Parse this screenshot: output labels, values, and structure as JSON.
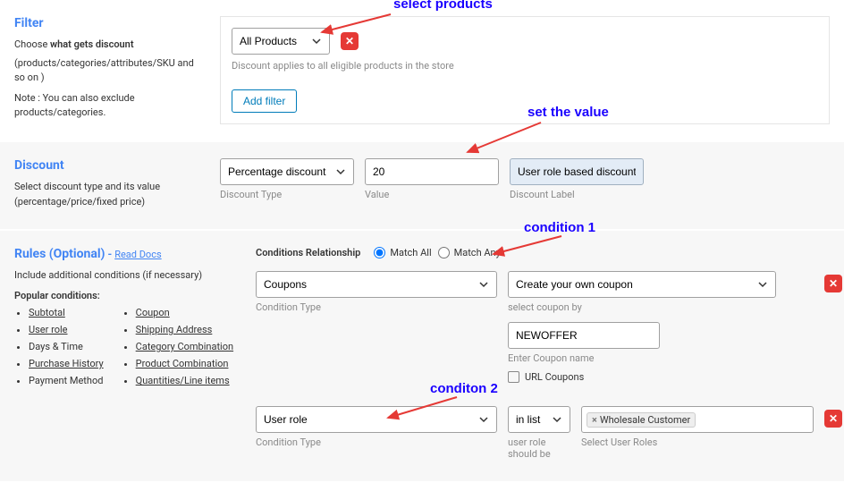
{
  "filter": {
    "title": "Filter",
    "choose_text": "Choose",
    "choose_bold": "what gets discount",
    "choose_rest": "(products/categories/attributes/SKU and so on )",
    "note": "Note : You can also exclude products/categories.",
    "select_value": "All Products",
    "applies_text": "Discount applies to all eligible products in the store",
    "add_filter": "Add filter"
  },
  "discount": {
    "title": "Discount",
    "side_text": "Select discount type and its value (percentage/price/fixed price)",
    "type_value": "Percentage discount",
    "type_label": "Discount Type",
    "value_value": "20",
    "value_label": "Value",
    "discount_label_value": "User role based discount",
    "discount_label_label": "Discount Label"
  },
  "rules": {
    "title": "Rules (Optional)",
    "read_docs": "Read Docs",
    "include_text": "Include additional conditions (if necessary)",
    "popular_label": "Popular conditions:",
    "col1": [
      "Subtotal",
      "User role",
      "Days & Time",
      "Purchase History",
      "Payment Method"
    ],
    "col2": [
      "Coupon",
      "Shipping Address",
      "Category Combination",
      "Product Combination",
      "Quantities/Line items"
    ],
    "relationship_label": "Conditions Relationship",
    "match_all": "Match All",
    "match_any": "Match Any",
    "cond1": {
      "type_value": "Coupons",
      "type_label": "Condition Type",
      "method_value": "Create your own coupon",
      "method_label": "select coupon by",
      "coupon_value": "NEWOFFER",
      "coupon_label": "Enter Coupon name",
      "url_coupons": "URL Coupons"
    },
    "cond2": {
      "type_value": "User role",
      "type_label": "Condition Type",
      "op_value": "in list",
      "op_label": "user role should be",
      "tag": "Wholesale Customer",
      "tag_placeholder": "Select User Roles"
    }
  },
  "annotations": {
    "a1": "select products",
    "a2": "set the value",
    "a3": "condition 1",
    "a4": "conditon 2"
  }
}
